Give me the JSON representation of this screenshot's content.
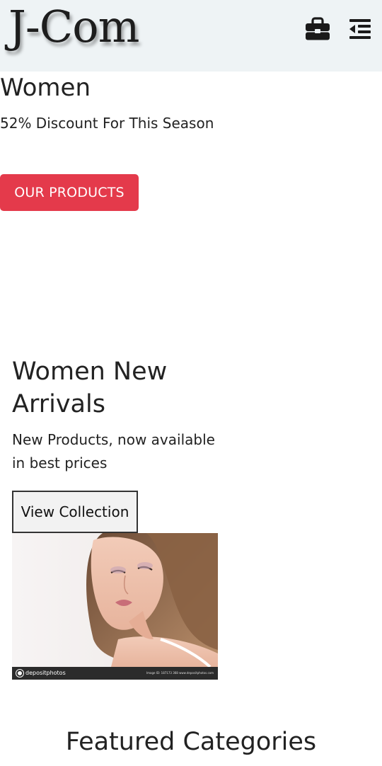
{
  "header": {
    "logo": "J-Com",
    "cart_icon": "briefcase-icon",
    "menu_icon": "menu-collapse-icon"
  },
  "hero": {
    "title": "Women",
    "subtitle": "52% Discount For This Season",
    "button_label": "OUR PRODUCTS"
  },
  "arrivals": {
    "title": "Women New Arrivals",
    "subtitle": "New Products, now available in best prices",
    "button_label": "View Collection",
    "image": {
      "watermark_brand": "depositphotos",
      "watermark_meta": "Image ID: 187173 368     www.depositphotos.com"
    }
  },
  "featured": {
    "title": "Featured Categories"
  },
  "colors": {
    "navbar_bg": "#eef3f5",
    "primary_button": "#e43a4b",
    "text": "#222222"
  }
}
